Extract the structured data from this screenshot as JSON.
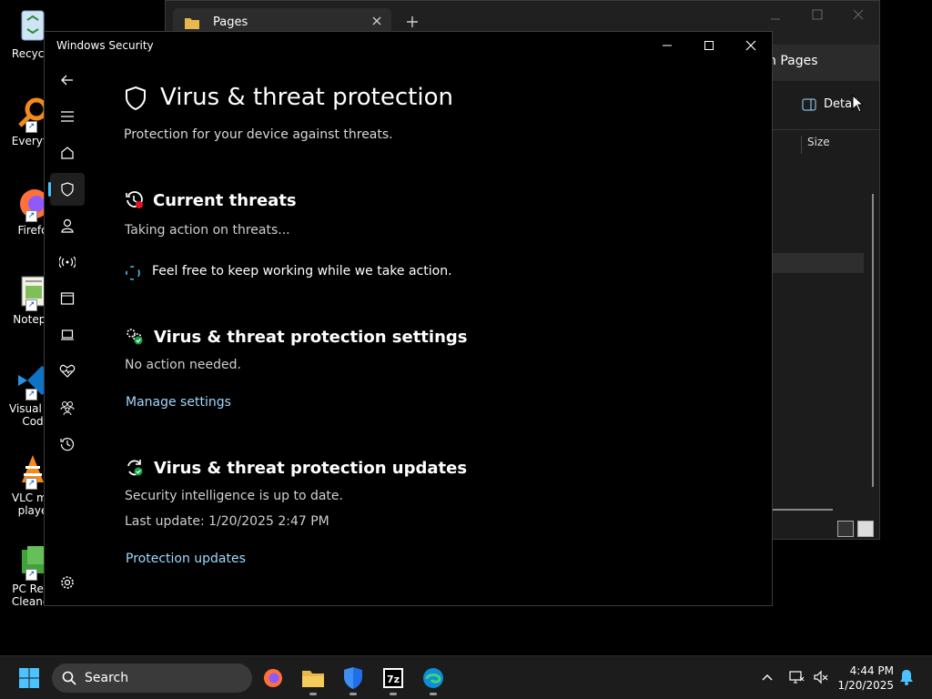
{
  "desktop": {
    "icons": [
      {
        "label": "Recycle",
        "icon": "recycle-bin-icon"
      },
      {
        "label": "Everyth",
        "icon": "everything-search-icon"
      },
      {
        "label": "Firefo",
        "icon": "firefox-icon"
      },
      {
        "label": "Notepa",
        "icon": "notepad-icon"
      },
      {
        "label": "Visual St Cod",
        "icon": "vscode-icon"
      },
      {
        "label": "VLC me playe",
        "icon": "vlc-icon"
      },
      {
        "label": "PC Regi Cleaner",
        "icon": "pc-registry-cleaner-icon"
      }
    ]
  },
  "explorer": {
    "tab_title": "Pages",
    "breadcrumb": "n Pages",
    "details_label": "Detail",
    "column_size": "Size"
  },
  "security": {
    "window_title": "Windows Security",
    "page_title": "Virus & threat protection",
    "page_subtitle": "Protection for your device against threats.",
    "current_threats": {
      "heading": "Current threats",
      "status": "Taking action on threats...",
      "message": "Feel free to keep working while we take action."
    },
    "settings": {
      "heading": "Virus & threat protection settings",
      "status": "No action needed.",
      "link": "Manage settings"
    },
    "updates": {
      "heading": "Virus & threat protection updates",
      "status": "Security intelligence is up to date.",
      "last_update": "Last update: 1/20/2025 2:47 PM",
      "link": "Protection updates"
    },
    "nav": [
      "back-icon",
      "menu-icon",
      "home-icon",
      "shield-icon",
      "account-icon",
      "wifi-icon",
      "app-browser-icon",
      "laptop-icon",
      "health-icon",
      "family-icon",
      "history-icon",
      "settings-icon"
    ]
  },
  "taskbar": {
    "search_label": "Search",
    "time": "4:44 PM",
    "date": "1/20/2025"
  },
  "colors": {
    "accent": "#4cc2ff",
    "link": "#9fd7ff",
    "taskbar_bg": "#1c1c1c"
  }
}
